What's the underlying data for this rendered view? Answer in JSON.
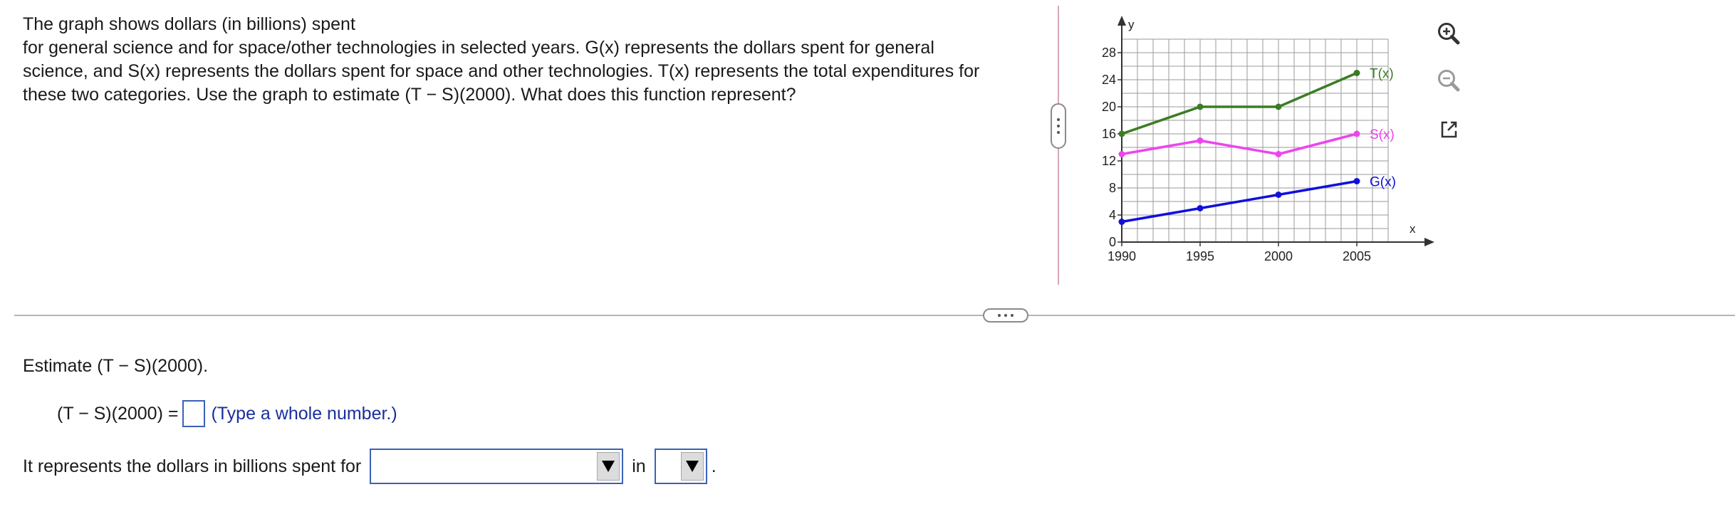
{
  "question": {
    "lines": [
      "The graph shows dollars (in billions) spent",
      "for general science and for space/other technologies in selected years. G(x) represents the dollars spent for general",
      "science, and S(x) represents the dollars spent for space and other technologies. T(x) represents the total expenditures for",
      "these two categories. Use the graph to estimate (T − S)(2000). What does this function represent?"
    ]
  },
  "chart_data": {
    "type": "line",
    "xlabel": "x",
    "ylabel": "y",
    "xlim": [
      1990,
      2007
    ],
    "ylim": [
      0,
      30
    ],
    "x_ticks": [
      1990,
      1995,
      2000,
      2005
    ],
    "y_ticks": [
      0,
      4,
      8,
      12,
      16,
      20,
      24,
      28
    ],
    "grid": true,
    "series": [
      {
        "name": "T(x)",
        "color": "#3b7d23",
        "x": [
          1990,
          1995,
          2000,
          2005
        ],
        "y": [
          16,
          20,
          20,
          25
        ]
      },
      {
        "name": "S(x)",
        "color": "#ee44ee",
        "x": [
          1990,
          1995,
          2000,
          2005
        ],
        "y": [
          13,
          15,
          13,
          16
        ]
      },
      {
        "name": "G(x)",
        "color": "#1010dd",
        "x": [
          1990,
          1995,
          2000,
          2005
        ],
        "y": [
          3,
          5,
          7,
          9
        ]
      }
    ]
  },
  "tools": {
    "zoom_in": "zoom-in-icon",
    "zoom_out": "zoom-out-icon",
    "popout": "popout-icon"
  },
  "part1": {
    "prompt": "Estimate (T − S)(2000).",
    "expression": "(T − S)(2000) =",
    "answer_value": "",
    "hint": "(Type a whole number.)"
  },
  "part2": {
    "prefix": "It represents the dollars in billions spent for",
    "dropdown1_value": "",
    "connector": "in",
    "dropdown2_value": "",
    "suffix": "."
  }
}
